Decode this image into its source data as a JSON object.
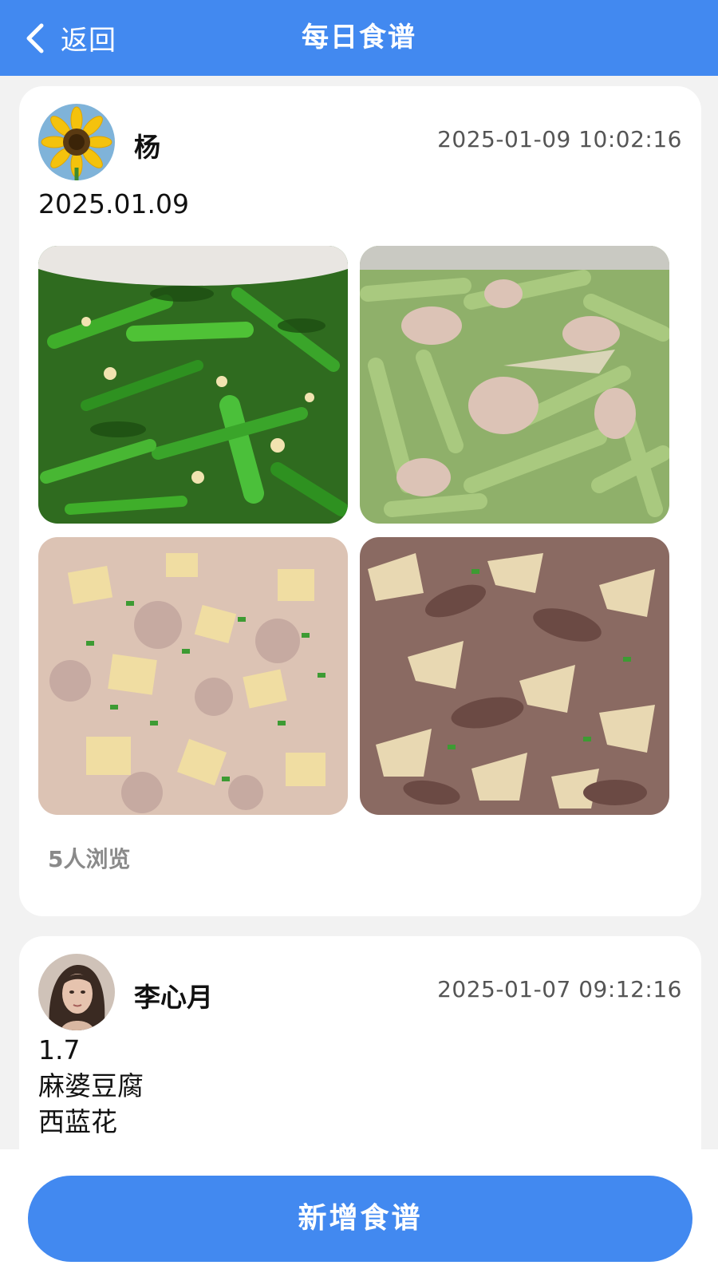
{
  "header": {
    "back_label": "返回",
    "title": "每日食谱",
    "color": "#4289f0"
  },
  "posts": [
    {
      "author": "杨",
      "avatar_icon": "sunflower-avatar",
      "time": "2025-01-09 10:02:16",
      "text": "2025.01.09",
      "photos": [
        "stir-fried-greens-photo",
        "green-beans-with-pork-photo",
        "potato-with-minced-pork-photo",
        "beef-with-tofu-skin-photo"
      ],
      "views": "5人浏览"
    },
    {
      "author": "李心月",
      "avatar_icon": "woman-portrait-avatar",
      "time": "2025-01-07 09:12:16",
      "text": "1.7\n麻婆豆腐\n西蓝花"
    }
  ],
  "footer": {
    "add_button_label": "新增食谱"
  }
}
